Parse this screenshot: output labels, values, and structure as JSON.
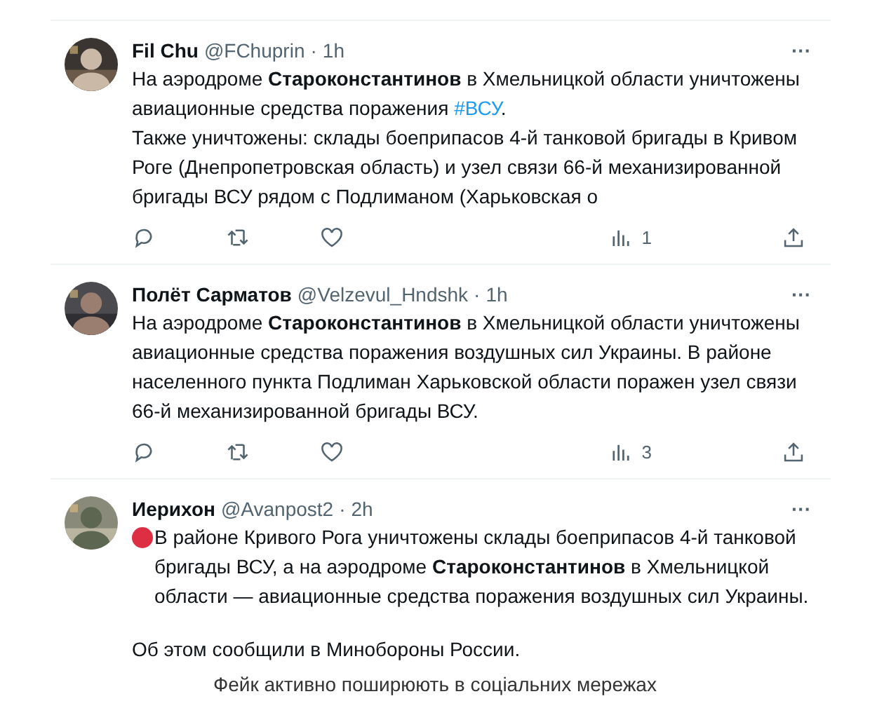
{
  "tweets": [
    {
      "name": "Fil Chu",
      "handle": "@FChuprin",
      "separator": "·",
      "time": "1h",
      "more": "···",
      "bullet": false,
      "paragraphs": [
        [
          "На аэродроме **Староконстантинов** в Хмельницкой области уничтожены",
          {
            "text": "авиационные средства поражения ",
            "link": "#ВСУ",
            "tail": "."
          },
          "Также уничтожены: склады боеприпасов 4-й танковой бригады в Кривом",
          "Роге (Днепропетровская область) и узел связи 66-й механизированной",
          "бригады ВСУ рядом с Подлиманом (Харьковская о"
        ]
      ],
      "views": "1"
    },
    {
      "name": "Полёт Сарматов",
      "handle": "@Velzevul_Hndshk",
      "separator": "·",
      "time": "1h",
      "more": "···",
      "bullet": false,
      "paragraphs": [
        [
          "На аэродроме **Староконстантинов** в Хмельницкой области уничтожены",
          "авиационные средства поражения воздушных сил Украины. В районе",
          "населенного пункта Подлиман Харьковской области поражен узел связи",
          "66-й механизированной бригады ВСУ."
        ]
      ],
      "views": "3"
    },
    {
      "name": "Иерихон",
      "handle": "@Avanpost2",
      "separator": "·",
      "time": "2h",
      "more": "···",
      "bullet": true,
      "paragraphs": [
        [
          "В районе Кривого Рога уничтожены склады боеприпасов 4-й танковой",
          "бригады ВСУ, а на аэродроме **Староконстантинов** в Хмельницкой",
          "области — авиационные средства поражения воздушных сил Украины."
        ],
        [
          "Об этом сообщили в Минобороны России."
        ]
      ]
    }
  ],
  "caption": "Фейк активно поширюють в соціальних мережах"
}
